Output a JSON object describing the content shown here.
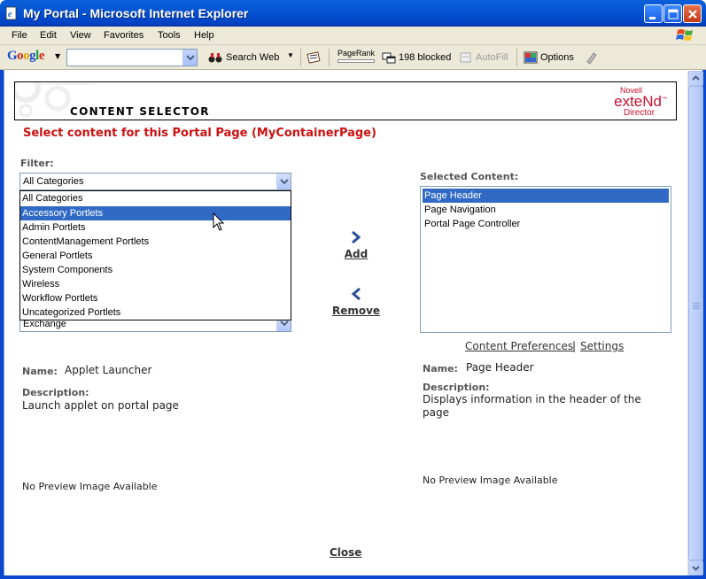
{
  "window": {
    "title": "My Portal - Microsoft Internet Explorer"
  },
  "menu": {
    "items": [
      "File",
      "Edit",
      "View",
      "Favorites",
      "Tools",
      "Help"
    ]
  },
  "google_toolbar": {
    "search_value": "",
    "search_web_label": "Search Web",
    "pagerank_label": "PageRank",
    "blocked_label": "198 blocked",
    "autofill_label": "AutoFill",
    "options_label": "Options"
  },
  "banner": {
    "title": "CONTENT SELECTOR",
    "brand_novell": "Novell",
    "brand_extend": "exteNd",
    "brand_director": "Director"
  },
  "heading": "Select content for this Portal Page (MyContainerPage)",
  "filter": {
    "label": "Filter:",
    "selected": "All Categories",
    "options": [
      "All Categories",
      "Accessory Portlets",
      "Admin Portlets",
      "ContentManagement Portlets",
      "General Portlets",
      "System Components",
      "Wireless",
      "Workflow Portlets",
      "Uncategorized Portlets"
    ],
    "highlighted": "Accessory Portlets",
    "below_value": "Exchange"
  },
  "actions": {
    "add": "Add",
    "remove": "Remove",
    "close": "Close"
  },
  "selected_content": {
    "label": "Selected Content:",
    "items": [
      "Page Header",
      "Page Navigation",
      "Portal Page Controller"
    ],
    "selected": "Page Header"
  },
  "links": {
    "content_preferences": "Content Preferences",
    "separator": "|",
    "settings": "Settings"
  },
  "left_detail": {
    "name_label": "Name:",
    "name_value": "Applet Launcher",
    "description_label": "Description:",
    "description_value": "Launch applet on portal page",
    "preview": "No Preview Image Available"
  },
  "right_detail": {
    "name_label": "Name:",
    "name_value": "Page Header",
    "description_label": "Description:",
    "description_line1": "Displays information in the header of the",
    "description_line2": "page",
    "preview": "No Preview Image Available"
  },
  "colors": {
    "accent_red": "#cc1111",
    "selection_blue": "#316ac5",
    "titlebar_blue": "#0554d1"
  }
}
